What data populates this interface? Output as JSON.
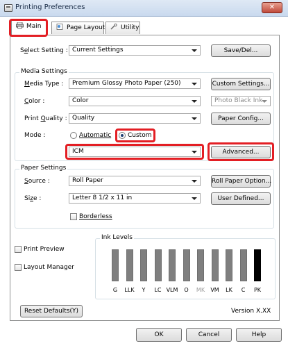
{
  "window": {
    "title": "Printing Preferences",
    "close_glyph": "✕"
  },
  "tabs": [
    {
      "label": "Main",
      "icon": "printer-icon"
    },
    {
      "label": "Page Layout",
      "icon": "page-layout-icon"
    },
    {
      "label": "Utility",
      "icon": "wrench-icon"
    }
  ],
  "select_setting": {
    "label_pre": "S",
    "label_u": "e",
    "label_post": "lect Setting :",
    "value": "Current Settings",
    "save_button": "Save/Del..."
  },
  "media_settings": {
    "group_title": "Media Settings",
    "media_type": {
      "label_pre": "",
      "label_u": "M",
      "label_post": "edia Type :",
      "value": "Premium Glossy Photo Paper (250)",
      "button": "Custom Settings..."
    },
    "color": {
      "label_pre": "",
      "label_u": "C",
      "label_post": "olor :",
      "value": "Color",
      "photo_black": "Photo Black Ink"
    },
    "print_quality": {
      "label_pre": "Print ",
      "label_u": "Q",
      "label_post": "uality :",
      "value": "Quality",
      "button": "Paper Config..."
    },
    "mode": {
      "label": "Mode :",
      "automatic": "Automatic",
      "custom": "Custom",
      "selected": "custom",
      "value": "ICM",
      "advanced_button": "Advanced..."
    }
  },
  "paper_settings": {
    "group_title": "Paper Settings",
    "source": {
      "label_pre": "",
      "label_u": "S",
      "label_post": "ource :",
      "value": "Roll Paper",
      "button": "Roll Paper Option..."
    },
    "size": {
      "label_pre": "Si",
      "label_u": "z",
      "label_post": "e :",
      "value": "Letter 8 1/2 x 11 in",
      "button": "User Defined..."
    },
    "borderless": "Borderless"
  },
  "options": {
    "print_preview": "Print Preview",
    "layout_manager": "Layout Manager"
  },
  "ink_levels": {
    "title": "Ink Levels",
    "inks": [
      {
        "label": "G",
        "level": 0.55,
        "color": "#7f7f7f",
        "dim": false
      },
      {
        "label": "LLK",
        "level": 0.55,
        "color": "#7f7f7f",
        "dim": false
      },
      {
        "label": "Y",
        "level": 0.55,
        "color": "#7f7f7f",
        "dim": false
      },
      {
        "label": "LC",
        "level": 0.55,
        "color": "#7f7f7f",
        "dim": false
      },
      {
        "label": "VLM",
        "level": 0.55,
        "color": "#7f7f7f",
        "dim": false
      },
      {
        "label": "O",
        "level": 0.55,
        "color": "#7f7f7f",
        "dim": false
      },
      {
        "label": "MK",
        "level": 0.55,
        "color": "#7f7f7f",
        "dim": true
      },
      {
        "label": "VM",
        "level": 0.55,
        "color": "#7f7f7f",
        "dim": false
      },
      {
        "label": "LK",
        "level": 0.55,
        "color": "#7f7f7f",
        "dim": false
      },
      {
        "label": "C",
        "level": 0.55,
        "color": "#7f7f7f",
        "dim": false
      },
      {
        "label": "PK",
        "level": 0.55,
        "color": "#000000",
        "dim": false
      }
    ]
  },
  "reset_defaults": "Reset Defaults(Y)",
  "version": "Version X.XX",
  "buttons": {
    "ok": "OK",
    "cancel": "Cancel",
    "help": "Help"
  },
  "colors": {
    "highlight": "#e31e24"
  }
}
